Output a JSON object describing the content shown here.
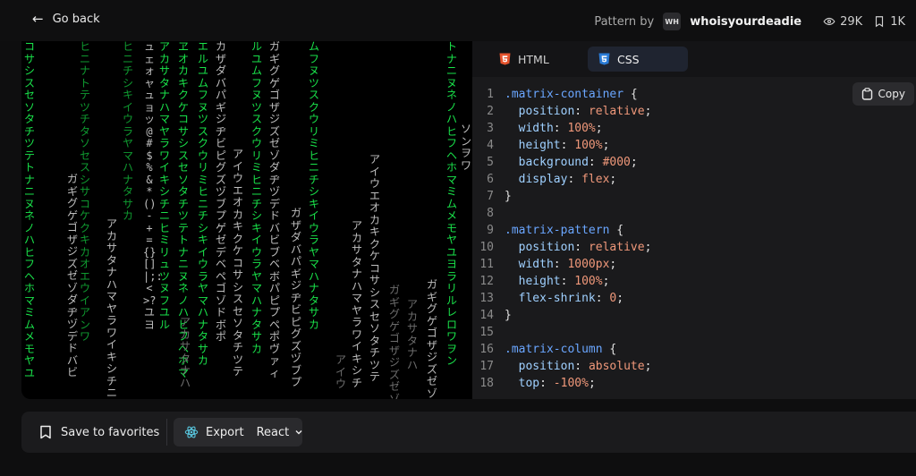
{
  "header": {
    "back_label": "Go back",
    "pattern_by": "Pattern by",
    "avatar_initials": "WH",
    "author": "whoisyourdeadie",
    "views": "29K",
    "saves": "1K"
  },
  "preview": {
    "columns": [
      {
        "t": "コサシスセソタチツテトナニヌネノハヒフヘホマミムメモヤユ",
        "c": "g"
      },
      {
        "t": "ガギグゲゴザジズゼゾダヂヅデドバビ",
        "c": "w"
      },
      {
        "t": "ヒニナトテツチタソセスシサコケクキカオエウイアンワ",
        "c": "gd"
      },
      {
        "t": "アカサタナハマヤラワイキシチニヒミリイキシチ",
        "c": "w"
      },
      {
        "t": "ヒニチシキイウラヤマハナタサカ",
        "c": "gd"
      },
      {
        "t": "ュェォャュョッ@#$%&*()-+={}[]|;:<>?ユヨ",
        "c": "w"
      },
      {
        "t": "アカサタナハマヤラワイキシチニヒミリュツヌフユル",
        "c": "g"
      },
      {
        "t": "ヱオカキクケコサシスセソタチツテトナニヌネノハヒフヘホマ",
        "c": "g"
      },
      {
        "t": "エルユムフヌツスクウリミヒニチシキイウラヤマハナタサカ",
        "c": "g"
      },
      {
        "t": "アカサタナハ",
        "c": "wd"
      },
      {
        "t": "カザダバパギジヂビピグズヅブプゲゼデベペゴゾドボポ",
        "c": "w"
      },
      {
        "t": "アイウエオカキクケコサシスセソタチツテ",
        "c": "w"
      },
      {
        "t": "ルユムフヌツスクウリミヒニチシキイウラヤマハナタサカ",
        "c": "g"
      },
      {
        "t": "ガギグゲゴザジズゼゾダヂヅデドバビブベボパピプペポヴァィ",
        "c": "w"
      },
      {
        "t": "ガザダバパギジヂビピグズヅブプ",
        "c": "w"
      },
      {
        "t": "ムフヌツスクウリミヒニチシキイウラヤマハナタサカ",
        "c": "g"
      },
      {
        "t": "アイウ",
        "c": "wd"
      },
      {
        "t": "アカサタナハマヤラワイキシチ",
        "c": "w"
      },
      {
        "t": "アイウエオカキクケコサシスセソタチツテ",
        "c": "w"
      },
      {
        "t": "ガギグゲゴザジズゼゾダ",
        "c": "wd"
      },
      {
        "t": "アカサタナハ",
        "c": "wd"
      },
      {
        "t": "ガギグゲゴザジズゼゾダヂ",
        "c": "w"
      },
      {
        "t": "トナニヌネノハヒフヘホマミムメモヤユヨラリルレロワヲン",
        "c": "g"
      },
      {
        "t": "ソンヲワ",
        "c": "w"
      }
    ]
  },
  "editor": {
    "tabs": [
      {
        "label": "HTML",
        "active": false
      },
      {
        "label": "CSS",
        "active": true
      }
    ],
    "copy_label": "Copy",
    "lines": [
      [
        {
          "t": ".matrix-container",
          "k": "sel"
        },
        {
          "t": " {",
          "k": "brace"
        }
      ],
      [
        {
          "t": "  position",
          "k": "prop"
        },
        {
          "t": ": ",
          "k": "txt"
        },
        {
          "t": "relative",
          "k": "val"
        },
        {
          "t": ";",
          "k": "txt"
        }
      ],
      [
        {
          "t": "  width",
          "k": "prop"
        },
        {
          "t": ": ",
          "k": "txt"
        },
        {
          "t": "100%",
          "k": "val"
        },
        {
          "t": ";",
          "k": "txt"
        }
      ],
      [
        {
          "t": "  height",
          "k": "prop"
        },
        {
          "t": ": ",
          "k": "txt"
        },
        {
          "t": "100%",
          "k": "val"
        },
        {
          "t": ";",
          "k": "txt"
        }
      ],
      [
        {
          "t": "  background",
          "k": "prop"
        },
        {
          "t": ": ",
          "k": "txt"
        },
        {
          "t": "#000",
          "k": "val"
        },
        {
          "t": ";",
          "k": "txt"
        }
      ],
      [
        {
          "t": "  display",
          "k": "prop"
        },
        {
          "t": ": ",
          "k": "txt"
        },
        {
          "t": "flex",
          "k": "val"
        },
        {
          "t": ";",
          "k": "txt"
        }
      ],
      [
        {
          "t": "}",
          "k": "brace"
        }
      ],
      [],
      [
        {
          "t": ".matrix-pattern",
          "k": "sel"
        },
        {
          "t": " {",
          "k": "brace"
        }
      ],
      [
        {
          "t": "  position",
          "k": "prop"
        },
        {
          "t": ": ",
          "k": "txt"
        },
        {
          "t": "relative",
          "k": "val"
        },
        {
          "t": ";",
          "k": "txt"
        }
      ],
      [
        {
          "t": "  width",
          "k": "prop"
        },
        {
          "t": ": ",
          "k": "txt"
        },
        {
          "t": "1000px",
          "k": "val"
        },
        {
          "t": ";",
          "k": "txt"
        }
      ],
      [
        {
          "t": "  height",
          "k": "prop"
        },
        {
          "t": ": ",
          "k": "txt"
        },
        {
          "t": "100%",
          "k": "val"
        },
        {
          "t": ";",
          "k": "txt"
        }
      ],
      [
        {
          "t": "  flex-shrink",
          "k": "prop"
        },
        {
          "t": ": ",
          "k": "txt"
        },
        {
          "t": "0",
          "k": "val"
        },
        {
          "t": ";",
          "k": "txt"
        }
      ],
      [
        {
          "t": "}",
          "k": "brace"
        }
      ],
      [],
      [
        {
          "t": ".matrix-column",
          "k": "sel"
        },
        {
          "t": " {",
          "k": "brace"
        }
      ],
      [
        {
          "t": "  position",
          "k": "prop"
        },
        {
          "t": ": ",
          "k": "txt"
        },
        {
          "t": "absolute",
          "k": "val"
        },
        {
          "t": ";",
          "k": "txt"
        }
      ],
      [
        {
          "t": "  top",
          "k": "prop"
        },
        {
          "t": ": ",
          "k": "txt"
        },
        {
          "t": "-100%",
          "k": "val"
        },
        {
          "t": ";",
          "k": "txt"
        }
      ]
    ]
  },
  "bottom": {
    "favorites_label": "Save to favorites",
    "export_label": "Export",
    "framework_label": "React"
  }
}
